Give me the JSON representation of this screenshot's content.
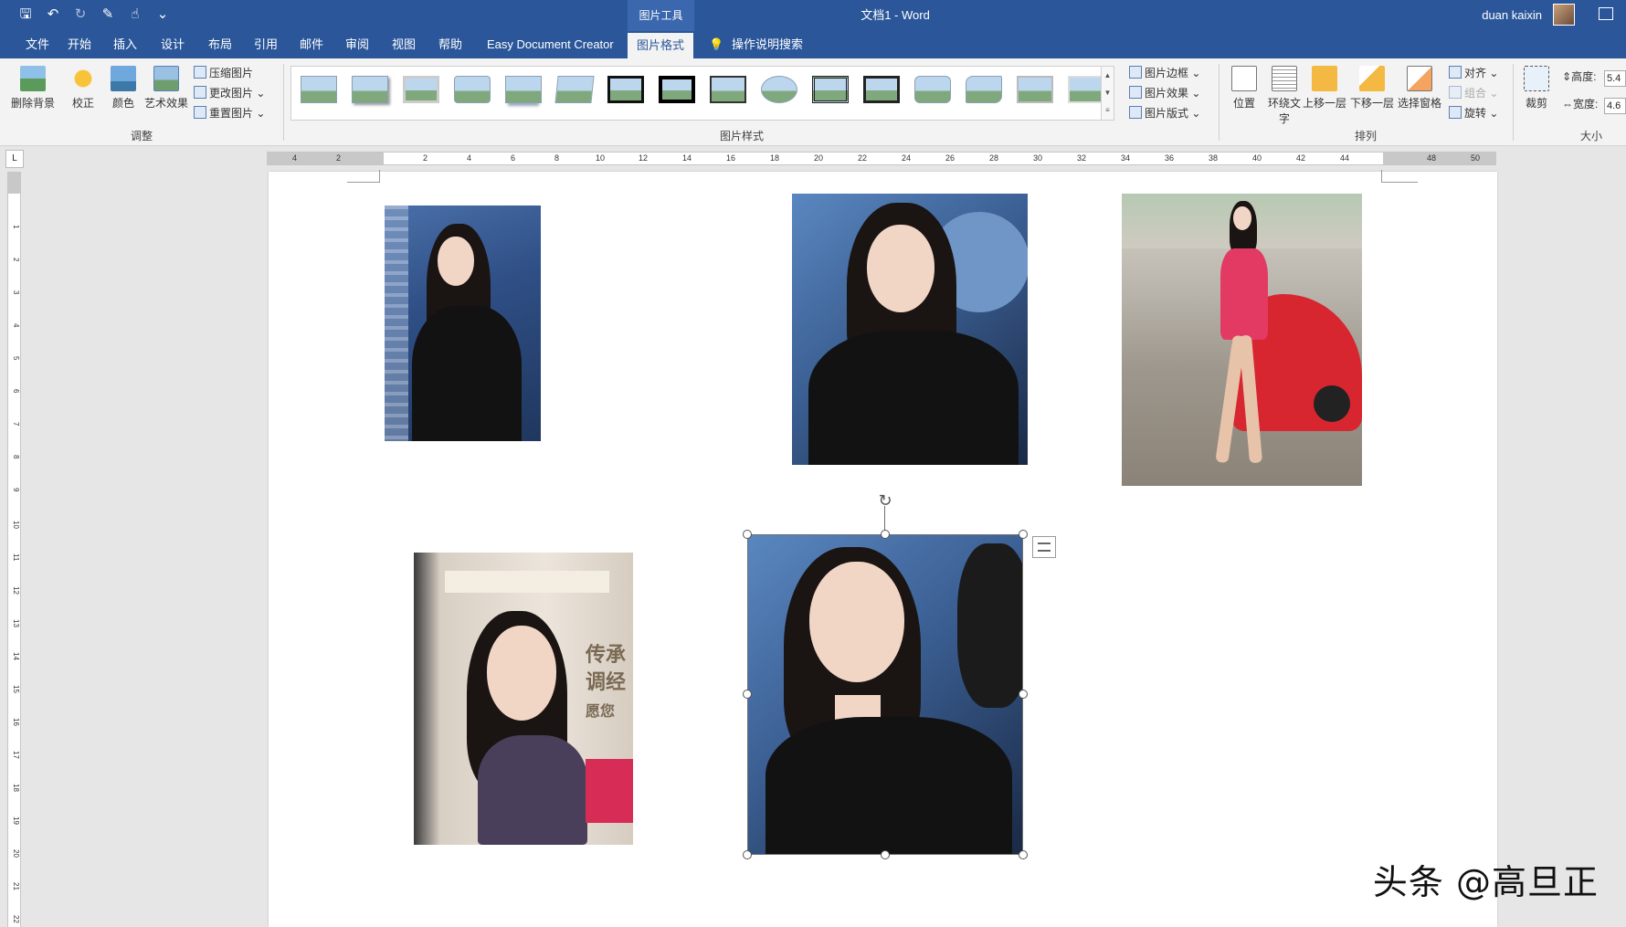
{
  "title_bar": {
    "context_tool": "图片工具",
    "doc_title": "文档1  -  Word",
    "user": "duan kaixin"
  },
  "tabs": [
    "文件",
    "开始",
    "插入",
    "设计",
    "布局",
    "引用",
    "邮件",
    "审阅",
    "视图",
    "帮助",
    "Easy Document Creator",
    "图片格式"
  ],
  "active_tab": "图片格式",
  "tell_me": "操作说明搜索",
  "ribbon": {
    "adjust": {
      "remove_bg": "删除背景",
      "correct": "校正",
      "color": "颜色",
      "art_effect": "艺术效果",
      "compress": "压缩图片",
      "change": "更改图片",
      "reset": "重置图片",
      "label": "调整"
    },
    "styles": {
      "border": "图片边框",
      "effects": "图片效果",
      "layout": "图片版式",
      "label": "图片样式"
    },
    "arrange": {
      "position": "位置",
      "wrap_text": "环绕文字",
      "bring_forward": "上移一层",
      "send_backward": "下移一层",
      "selection_pane": "选择窗格",
      "align": "对齐",
      "group": "组合",
      "rotate": "旋转",
      "label": "排列"
    },
    "size": {
      "crop": "裁剪",
      "height_label": "高度:",
      "height_value": "5.4",
      "width_label": "宽度:",
      "width_value": "4.6",
      "label": "大小"
    }
  },
  "ruler": {
    "ticks": [
      "4",
      "2",
      "2",
      "4",
      "6",
      "8",
      "10",
      "12",
      "14",
      "16",
      "18",
      "20",
      "22",
      "24",
      "26",
      "28",
      "30",
      "32",
      "34",
      "36",
      "38",
      "40",
      "42",
      "44",
      "48",
      "50"
    ]
  },
  "vruler_numbers": [
    "1",
    "2",
    "3",
    "4",
    "5",
    "6",
    "7",
    "8",
    "9",
    "10",
    "11",
    "12",
    "13",
    "14",
    "15",
    "16",
    "17",
    "18",
    "19",
    "20",
    "21",
    "22"
  ],
  "poster_text": [
    "传承",
    "调经",
    "愿您"
  ],
  "watermark": "头条 @高旦正"
}
